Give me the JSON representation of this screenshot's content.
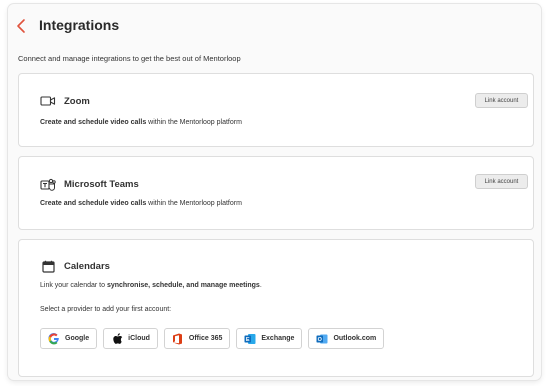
{
  "header": {
    "title": "Integrations"
  },
  "subtitle": "Connect and manage integrations to get the best out of Mentorloop",
  "zoom": {
    "title": "Zoom",
    "desc_bold": "Create and schedule video calls",
    "desc_rest": " within the Mentorloop platform",
    "button": "Link account"
  },
  "teams": {
    "title": "Microsoft Teams",
    "desc_bold": "Create and schedule video calls",
    "desc_rest": " within the Mentorloop platform",
    "button": "Link account"
  },
  "calendars": {
    "title": "Calendars",
    "desc_pre": "Link your calendar to ",
    "desc_bold": "synchronise, schedule, and manage meetings",
    "desc_post": ".",
    "prompt": "Select a provider to add your first account:",
    "providers": [
      {
        "label": "Google",
        "icon": "google-icon"
      },
      {
        "label": "iCloud",
        "icon": "apple-icon"
      },
      {
        "label": "Office 365",
        "icon": "office-icon"
      },
      {
        "label": "Exchange",
        "icon": "exchange-icon"
      },
      {
        "label": "Outlook.com",
        "icon": "outlook-icon"
      }
    ]
  },
  "colors": {
    "back": "#e0533d",
    "google_blue": "#4285f4",
    "office_red": "#dc3e15",
    "ms_blue": "#0f6cbd"
  }
}
